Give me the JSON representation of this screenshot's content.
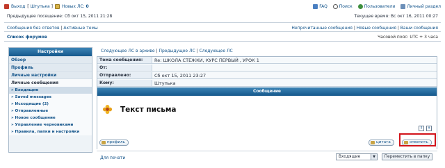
{
  "header": {
    "logout": "Выход",
    "username": "Штупька",
    "new_pm_label": "Новых ЛС:",
    "new_pm_count": "0",
    "faq": "FAQ",
    "search": "Поиск",
    "members": "Пользователи",
    "ucp": "Личный раздел",
    "last_visit": "Предыдущее посещение: Сб окт 15, 2011 21:28",
    "current_time": "Текущее время: Вс окт 16, 2011 00:27"
  },
  "nav": {
    "left": [
      "Сообщения без ответов",
      "Активные темы"
    ],
    "right": [
      "Непрочитанные сообщения",
      "Новые сообщения",
      "Ваши сообщения"
    ],
    "forum_index": "Список форумов",
    "timezone": "Часовой пояс: UTC + 3 часа"
  },
  "sidebar": {
    "title": "Настройки",
    "items": [
      "Обзор",
      "Профиль",
      "Личные настройки"
    ],
    "section": "Личные сообщения",
    "subitems": [
      "» Входящие",
      "» Saved messages",
      "» Исходящие (2)",
      "» Отправленные",
      "» Новое сообщение",
      "» Управление черновиками",
      "» Правила, папки и настройки"
    ]
  },
  "pm": {
    "nav_links": [
      "Следующее ЛС в архиве",
      "Предыдущее ЛС",
      "Следующее ЛС"
    ],
    "fields": [
      {
        "key": "Тема сообщения:",
        "value": "Re: ШКОЛА СТЕЖКИ, КУРС ПЕРВЫЙ , УРОК 1"
      },
      {
        "key": "От:",
        "value": ""
      },
      {
        "key": "Отправлено:",
        "value": "Сб окт 15, 2011 23:27"
      },
      {
        "key": "Кому:",
        "value": "Штупька"
      }
    ],
    "message_header": "Сообщение",
    "body": "Текст письма",
    "info_btn": "!",
    "top_btn": "↑",
    "profile_btn": "профиль",
    "quote_btn": "цитата",
    "reply_btn": "ответить"
  },
  "footer": {
    "print": "Для печати",
    "folder_select": "Входящие",
    "move_btn": "Переместить в папку"
  }
}
